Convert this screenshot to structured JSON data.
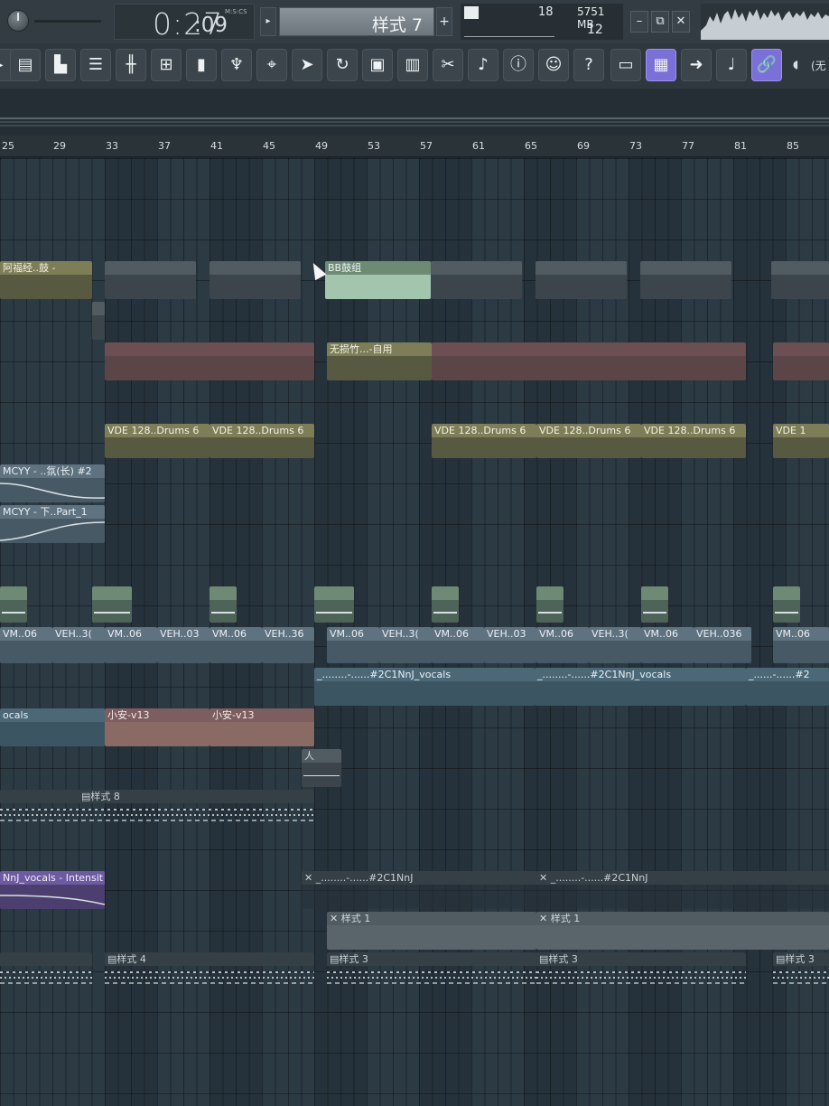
{
  "transport": {
    "time_main": "0:27",
    "time_cs": ":09",
    "time_format": "M:S:CS",
    "play_arrow": "▸",
    "pattern_label": "样式 7",
    "pattern_add": "+"
  },
  "monitor": {
    "cpu": "18",
    "memory": "5751 MB",
    "polyphony": "12"
  },
  "window_buttons": {
    "minimize": "–",
    "maximize": "⧉",
    "close": "✕"
  },
  "toolbar": {
    "icons": [
      "playlist-icon",
      "piano-roll-icon",
      "channel-rack-icon",
      "mixer-icon",
      "browser-icon",
      "plugin-picker-icon",
      "plugin-icon",
      "step-seq-icon",
      "scrub-icon",
      "loop-icon",
      "save-icon",
      "render-icon",
      "cut-icon",
      "record-audio-icon",
      "info-icon",
      "help-bubble-icon",
      "help-icon",
      "typing-keyboard-icon",
      "piano-keyboard-icon",
      "next-arrow-icon",
      "slide-icon",
      "link-icon"
    ],
    "more_label": "(无"
  },
  "ruler": {
    "bars": [
      "25",
      "29",
      "33",
      "37",
      "41",
      "45",
      "49",
      "53",
      "57",
      "61",
      "65",
      "69",
      "73",
      "77",
      "81",
      "85"
    ]
  },
  "clips": {
    "afu": "阿福经..鼓 -",
    "bb": "BB鼓组",
    "wusun": "无损竹...-自用",
    "vde1": "VDE 128..Drums 6",
    "vde2": "VDE 128..Drums 6",
    "vde3": "VDE 128..Drums 6",
    "vde4": "VDE 128..Drums 6",
    "vde5": "VDE 128..Drums 6",
    "vde6": "VDE 1",
    "mcyy1": "MCYY - ..氛(长) #2",
    "mcyy2": "MCYY - 下..Part_1",
    "vm": [
      "VM..06",
      "VEH..3(",
      "VM..06",
      "VEH..03",
      "VM..06",
      "VEH..36",
      "VM..06",
      "VEH..3(",
      "VM..06",
      "VEH..03",
      "VM..06",
      "VEH..3(",
      "VM..06",
      "VEH..036",
      "VM..06"
    ],
    "vocals_a": "_........-......#2C1NnJ_vocals",
    "vocals_b": "_........-......#2C1NnJ_vocals",
    "vocals_c": "_......-......#2",
    "vocals_left": "ocals",
    "xiaoan1": "小安-v13",
    "xiaoan2": "小安-v13",
    "ren": "人",
    "pattern8": "样式 8",
    "intensity": "NnJ_vocals - Intensit",
    "ghost_a": "_........-......#2C1NnJ",
    "ghost_b": "_........-......#2C1NnJ",
    "pattern1_a": "样式 1",
    "pattern1_b": "样式 1",
    "pattern4": "样式 4",
    "pattern3_a": "样式 3",
    "pattern3_b": "样式 3",
    "pattern3_c": "样式 3"
  },
  "colors": {
    "accent": "#7b6fd8",
    "grid_bg": "#2c3a44",
    "toolbar_bg": "#2f383e"
  }
}
